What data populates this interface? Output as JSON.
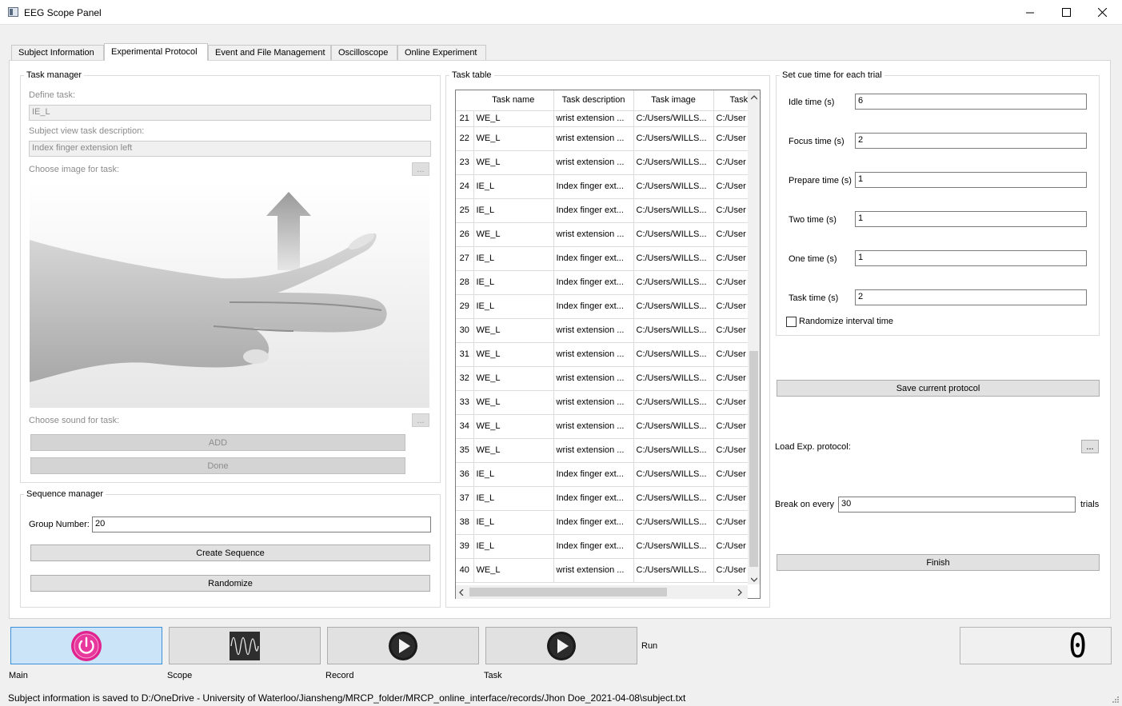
{
  "window": {
    "title": "EEG Scope Panel",
    "controls": [
      "minimize-icon",
      "maximize-icon",
      "close-icon"
    ]
  },
  "tabs": [
    {
      "label": "Subject Information",
      "active": false
    },
    {
      "label": "Experimental Protocol",
      "active": true
    },
    {
      "label": "Event and File Management",
      "active": false
    },
    {
      "label": "Oscilloscope",
      "active": false
    },
    {
      "label": "Online Experiment",
      "active": false
    }
  ],
  "task_manager": {
    "title": "Task manager",
    "define_task_label": "Define task:",
    "define_task_value": "IE_L",
    "description_label": "Subject view task description:",
    "description_value": "Index finger extension left",
    "image_label": "Choose image for task:",
    "image_button": "...",
    "sound_label": "Choose sound for task:",
    "sound_button": "...",
    "add_button": "ADD",
    "done_button": "Done"
  },
  "sequence_manager": {
    "title": "Sequence manager",
    "group_number_label": "Group Number:",
    "group_number_value": "20",
    "create_button": "Create Sequence",
    "randomize_button": "Randomize"
  },
  "task_table": {
    "title": "Task table",
    "columns": [
      "Task name",
      "Task description",
      "Task image",
      "Task"
    ],
    "rows": [
      {
        "num": "21",
        "name": "WE_L",
        "desc": "wrist extension ...",
        "image": "C:/Users/WILLS...",
        "task": "C:/User"
      },
      {
        "num": "22",
        "name": "WE_L",
        "desc": "wrist extension ...",
        "image": "C:/Users/WILLS...",
        "task": "C:/User"
      },
      {
        "num": "23",
        "name": "WE_L",
        "desc": "wrist extension ...",
        "image": "C:/Users/WILLS...",
        "task": "C:/User"
      },
      {
        "num": "24",
        "name": "IE_L",
        "desc": "Index finger ext...",
        "image": "C:/Users/WILLS...",
        "task": "C:/User"
      },
      {
        "num": "25",
        "name": "IE_L",
        "desc": "Index finger ext...",
        "image": "C:/Users/WILLS...",
        "task": "C:/User"
      },
      {
        "num": "26",
        "name": "WE_L",
        "desc": "wrist extension ...",
        "image": "C:/Users/WILLS...",
        "task": "C:/User"
      },
      {
        "num": "27",
        "name": "IE_L",
        "desc": "Index finger ext...",
        "image": "C:/Users/WILLS...",
        "task": "C:/User"
      },
      {
        "num": "28",
        "name": "IE_L",
        "desc": "Index finger ext...",
        "image": "C:/Users/WILLS...",
        "task": "C:/User"
      },
      {
        "num": "29",
        "name": "IE_L",
        "desc": "Index finger ext...",
        "image": "C:/Users/WILLS...",
        "task": "C:/User"
      },
      {
        "num": "30",
        "name": "WE_L",
        "desc": "wrist extension ...",
        "image": "C:/Users/WILLS...",
        "task": "C:/User"
      },
      {
        "num": "31",
        "name": "WE_L",
        "desc": "wrist extension ...",
        "image": "C:/Users/WILLS...",
        "task": "C:/User"
      },
      {
        "num": "32",
        "name": "WE_L",
        "desc": "wrist extension ...",
        "image": "C:/Users/WILLS...",
        "task": "C:/User"
      },
      {
        "num": "33",
        "name": "WE_L",
        "desc": "wrist extension ...",
        "image": "C:/Users/WILLS...",
        "task": "C:/User"
      },
      {
        "num": "34",
        "name": "WE_L",
        "desc": "wrist extension ...",
        "image": "C:/Users/WILLS...",
        "task": "C:/User"
      },
      {
        "num": "35",
        "name": "WE_L",
        "desc": "wrist extension ...",
        "image": "C:/Users/WILLS...",
        "task": "C:/User"
      },
      {
        "num": "36",
        "name": "IE_L",
        "desc": "Index finger ext...",
        "image": "C:/Users/WILLS...",
        "task": "C:/User"
      },
      {
        "num": "37",
        "name": "IE_L",
        "desc": "Index finger ext...",
        "image": "C:/Users/WILLS...",
        "task": "C:/User"
      },
      {
        "num": "38",
        "name": "IE_L",
        "desc": "Index finger ext...",
        "image": "C:/Users/WILLS...",
        "task": "C:/User"
      },
      {
        "num": "39",
        "name": "IE_L",
        "desc": "Index finger ext...",
        "image": "C:/Users/WILLS...",
        "task": "C:/User"
      },
      {
        "num": "40",
        "name": "WE_L",
        "desc": "wrist extension ...",
        "image": "C:/Users/WILLS...",
        "task": "C:/User"
      }
    ]
  },
  "cue_time": {
    "title": "Set cue time for each trial",
    "fields": [
      {
        "label": "Idle time (s)",
        "value": "6"
      },
      {
        "label": "Focus time (s)",
        "value": "2"
      },
      {
        "label": "Prepare time (s)",
        "value": "1"
      },
      {
        "label": "Two time (s)",
        "value": "1"
      },
      {
        "label": "One  time (s)",
        "value": "1"
      },
      {
        "label": "Task time (s)",
        "value": "2"
      }
    ],
    "randomize_label": "Randomize interval time",
    "randomize_checked": false
  },
  "protocol": {
    "save_button": "Save current protocol",
    "load_label": "Load Exp. protocol:",
    "load_button": "...",
    "break_label": "Break on every",
    "break_value": "30",
    "break_unit": "trials",
    "finish_button": "Finish"
  },
  "bottom": {
    "main_label": "Main",
    "scope_label": "Scope",
    "record_label": "Record",
    "task_label": "Task",
    "run_label": "Run",
    "counter_value": "0",
    "power_color": "#e0238f"
  },
  "status": "Subject information is saved to D:/OneDrive - University of Waterloo/Jiansheng/MRCP_folder/MRCP_online_interface/records/Jhon Doe_2021-04-08\\subject.txt"
}
